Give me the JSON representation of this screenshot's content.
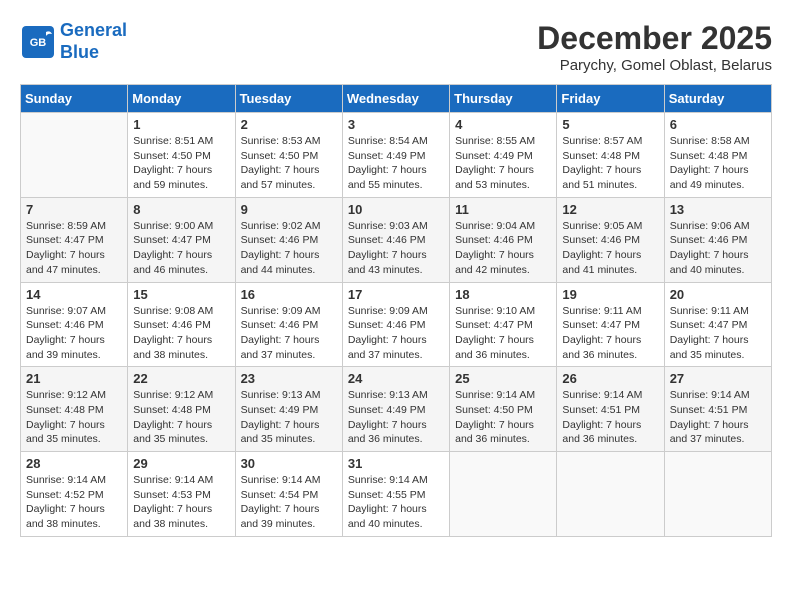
{
  "header": {
    "logo_line1": "General",
    "logo_line2": "Blue",
    "month": "December 2025",
    "location": "Parychy, Gomel Oblast, Belarus"
  },
  "days_of_week": [
    "Sunday",
    "Monday",
    "Tuesday",
    "Wednesday",
    "Thursday",
    "Friday",
    "Saturday"
  ],
  "weeks": [
    [
      {
        "day": "",
        "info": ""
      },
      {
        "day": "1",
        "info": "Sunrise: 8:51 AM\nSunset: 4:50 PM\nDaylight: 7 hours\nand 59 minutes."
      },
      {
        "day": "2",
        "info": "Sunrise: 8:53 AM\nSunset: 4:50 PM\nDaylight: 7 hours\nand 57 minutes."
      },
      {
        "day": "3",
        "info": "Sunrise: 8:54 AM\nSunset: 4:49 PM\nDaylight: 7 hours\nand 55 minutes."
      },
      {
        "day": "4",
        "info": "Sunrise: 8:55 AM\nSunset: 4:49 PM\nDaylight: 7 hours\nand 53 minutes."
      },
      {
        "day": "5",
        "info": "Sunrise: 8:57 AM\nSunset: 4:48 PM\nDaylight: 7 hours\nand 51 minutes."
      },
      {
        "day": "6",
        "info": "Sunrise: 8:58 AM\nSunset: 4:48 PM\nDaylight: 7 hours\nand 49 minutes."
      }
    ],
    [
      {
        "day": "7",
        "info": "Sunrise: 8:59 AM\nSunset: 4:47 PM\nDaylight: 7 hours\nand 47 minutes."
      },
      {
        "day": "8",
        "info": "Sunrise: 9:00 AM\nSunset: 4:47 PM\nDaylight: 7 hours\nand 46 minutes."
      },
      {
        "day": "9",
        "info": "Sunrise: 9:02 AM\nSunset: 4:46 PM\nDaylight: 7 hours\nand 44 minutes."
      },
      {
        "day": "10",
        "info": "Sunrise: 9:03 AM\nSunset: 4:46 PM\nDaylight: 7 hours\nand 43 minutes."
      },
      {
        "day": "11",
        "info": "Sunrise: 9:04 AM\nSunset: 4:46 PM\nDaylight: 7 hours\nand 42 minutes."
      },
      {
        "day": "12",
        "info": "Sunrise: 9:05 AM\nSunset: 4:46 PM\nDaylight: 7 hours\nand 41 minutes."
      },
      {
        "day": "13",
        "info": "Sunrise: 9:06 AM\nSunset: 4:46 PM\nDaylight: 7 hours\nand 40 minutes."
      }
    ],
    [
      {
        "day": "14",
        "info": "Sunrise: 9:07 AM\nSunset: 4:46 PM\nDaylight: 7 hours\nand 39 minutes."
      },
      {
        "day": "15",
        "info": "Sunrise: 9:08 AM\nSunset: 4:46 PM\nDaylight: 7 hours\nand 38 minutes."
      },
      {
        "day": "16",
        "info": "Sunrise: 9:09 AM\nSunset: 4:46 PM\nDaylight: 7 hours\nand 37 minutes."
      },
      {
        "day": "17",
        "info": "Sunrise: 9:09 AM\nSunset: 4:46 PM\nDaylight: 7 hours\nand 37 minutes."
      },
      {
        "day": "18",
        "info": "Sunrise: 9:10 AM\nSunset: 4:47 PM\nDaylight: 7 hours\nand 36 minutes."
      },
      {
        "day": "19",
        "info": "Sunrise: 9:11 AM\nSunset: 4:47 PM\nDaylight: 7 hours\nand 36 minutes."
      },
      {
        "day": "20",
        "info": "Sunrise: 9:11 AM\nSunset: 4:47 PM\nDaylight: 7 hours\nand 35 minutes."
      }
    ],
    [
      {
        "day": "21",
        "info": "Sunrise: 9:12 AM\nSunset: 4:48 PM\nDaylight: 7 hours\nand 35 minutes."
      },
      {
        "day": "22",
        "info": "Sunrise: 9:12 AM\nSunset: 4:48 PM\nDaylight: 7 hours\nand 35 minutes."
      },
      {
        "day": "23",
        "info": "Sunrise: 9:13 AM\nSunset: 4:49 PM\nDaylight: 7 hours\nand 35 minutes."
      },
      {
        "day": "24",
        "info": "Sunrise: 9:13 AM\nSunset: 4:49 PM\nDaylight: 7 hours\nand 36 minutes."
      },
      {
        "day": "25",
        "info": "Sunrise: 9:14 AM\nSunset: 4:50 PM\nDaylight: 7 hours\nand 36 minutes."
      },
      {
        "day": "26",
        "info": "Sunrise: 9:14 AM\nSunset: 4:51 PM\nDaylight: 7 hours\nand 36 minutes."
      },
      {
        "day": "27",
        "info": "Sunrise: 9:14 AM\nSunset: 4:51 PM\nDaylight: 7 hours\nand 37 minutes."
      }
    ],
    [
      {
        "day": "28",
        "info": "Sunrise: 9:14 AM\nSunset: 4:52 PM\nDaylight: 7 hours\nand 38 minutes."
      },
      {
        "day": "29",
        "info": "Sunrise: 9:14 AM\nSunset: 4:53 PM\nDaylight: 7 hours\nand 38 minutes."
      },
      {
        "day": "30",
        "info": "Sunrise: 9:14 AM\nSunset: 4:54 PM\nDaylight: 7 hours\nand 39 minutes."
      },
      {
        "day": "31",
        "info": "Sunrise: 9:14 AM\nSunset: 4:55 PM\nDaylight: 7 hours\nand 40 minutes."
      },
      {
        "day": "",
        "info": ""
      },
      {
        "day": "",
        "info": ""
      },
      {
        "day": "",
        "info": ""
      }
    ]
  ]
}
